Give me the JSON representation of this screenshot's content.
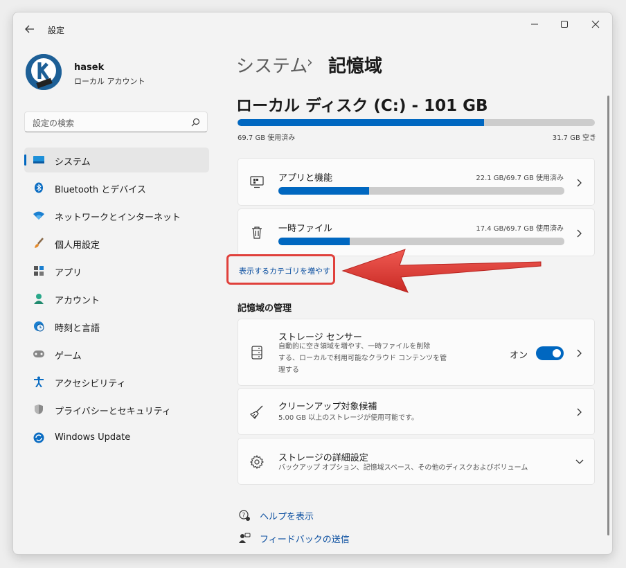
{
  "window": {
    "title": "設定"
  },
  "user": {
    "name": "hasek",
    "account_type": "ローカル アカウント"
  },
  "search": {
    "placeholder": "設定の検索"
  },
  "nav": {
    "items": [
      {
        "label": "システム",
        "icon": "monitor-icon",
        "active": true
      },
      {
        "label": "Bluetooth とデバイス",
        "icon": "bluetooth-icon"
      },
      {
        "label": "ネットワークとインターネット",
        "icon": "wifi-icon"
      },
      {
        "label": "個人用設定",
        "icon": "brush-icon"
      },
      {
        "label": "アプリ",
        "icon": "apps-icon"
      },
      {
        "label": "アカウント",
        "icon": "person-icon"
      },
      {
        "label": "時刻と言語",
        "icon": "globe-clock-icon"
      },
      {
        "label": "ゲーム",
        "icon": "gamepad-icon"
      },
      {
        "label": "アクセシビリティ",
        "icon": "accessibility-icon"
      },
      {
        "label": "プライバシーとセキュリティ",
        "icon": "shield-icon"
      },
      {
        "label": "Windows Update",
        "icon": "update-icon"
      }
    ]
  },
  "breadcrumb": {
    "parent": "システム",
    "separator": "›",
    "current": "記憶域"
  },
  "disk": {
    "title": "ローカル ディスク (C:) - 101 GB",
    "used_text": "69.7 GB 使用済み",
    "free_text": "31.7 GB 空き",
    "used_fraction": 0.69
  },
  "categories": [
    {
      "title": "アプリと機能",
      "value": "22.1 GB/69.7 GB 使用済み",
      "fraction": 0.317,
      "icon": "apps-features-icon"
    },
    {
      "title": "一時ファイル",
      "value": "17.4 GB/69.7 GB 使用済み",
      "fraction": 0.25,
      "icon": "trash-icon"
    }
  ],
  "more_categories_link": "表示するカテゴリを増やす",
  "management": {
    "heading": "記憶域の管理",
    "sensor": {
      "title": "ストレージ センサー",
      "desc_line1": "自動的に空き領域を増やす、一時ファイルを削除",
      "desc_line2": "する、ローカルで利用可能なクラウド コンテンツを管",
      "desc_line3": "理する",
      "toggle_label": "オン",
      "toggle_on": true
    },
    "cleanup": {
      "title": "クリーンアップ対象候補",
      "desc": "5.00 GB 以上のストレージが使用可能です。"
    },
    "advanced": {
      "title": "ストレージの詳細設定",
      "desc": "バックアップ オプション、記憶域スペース、その他のディスクおよびボリューム"
    }
  },
  "footer": {
    "help": "ヘルプを表示",
    "feedback": "フィードバックの送信"
  },
  "colors": {
    "accent": "#0067c0",
    "annotation": "#e0403b"
  }
}
